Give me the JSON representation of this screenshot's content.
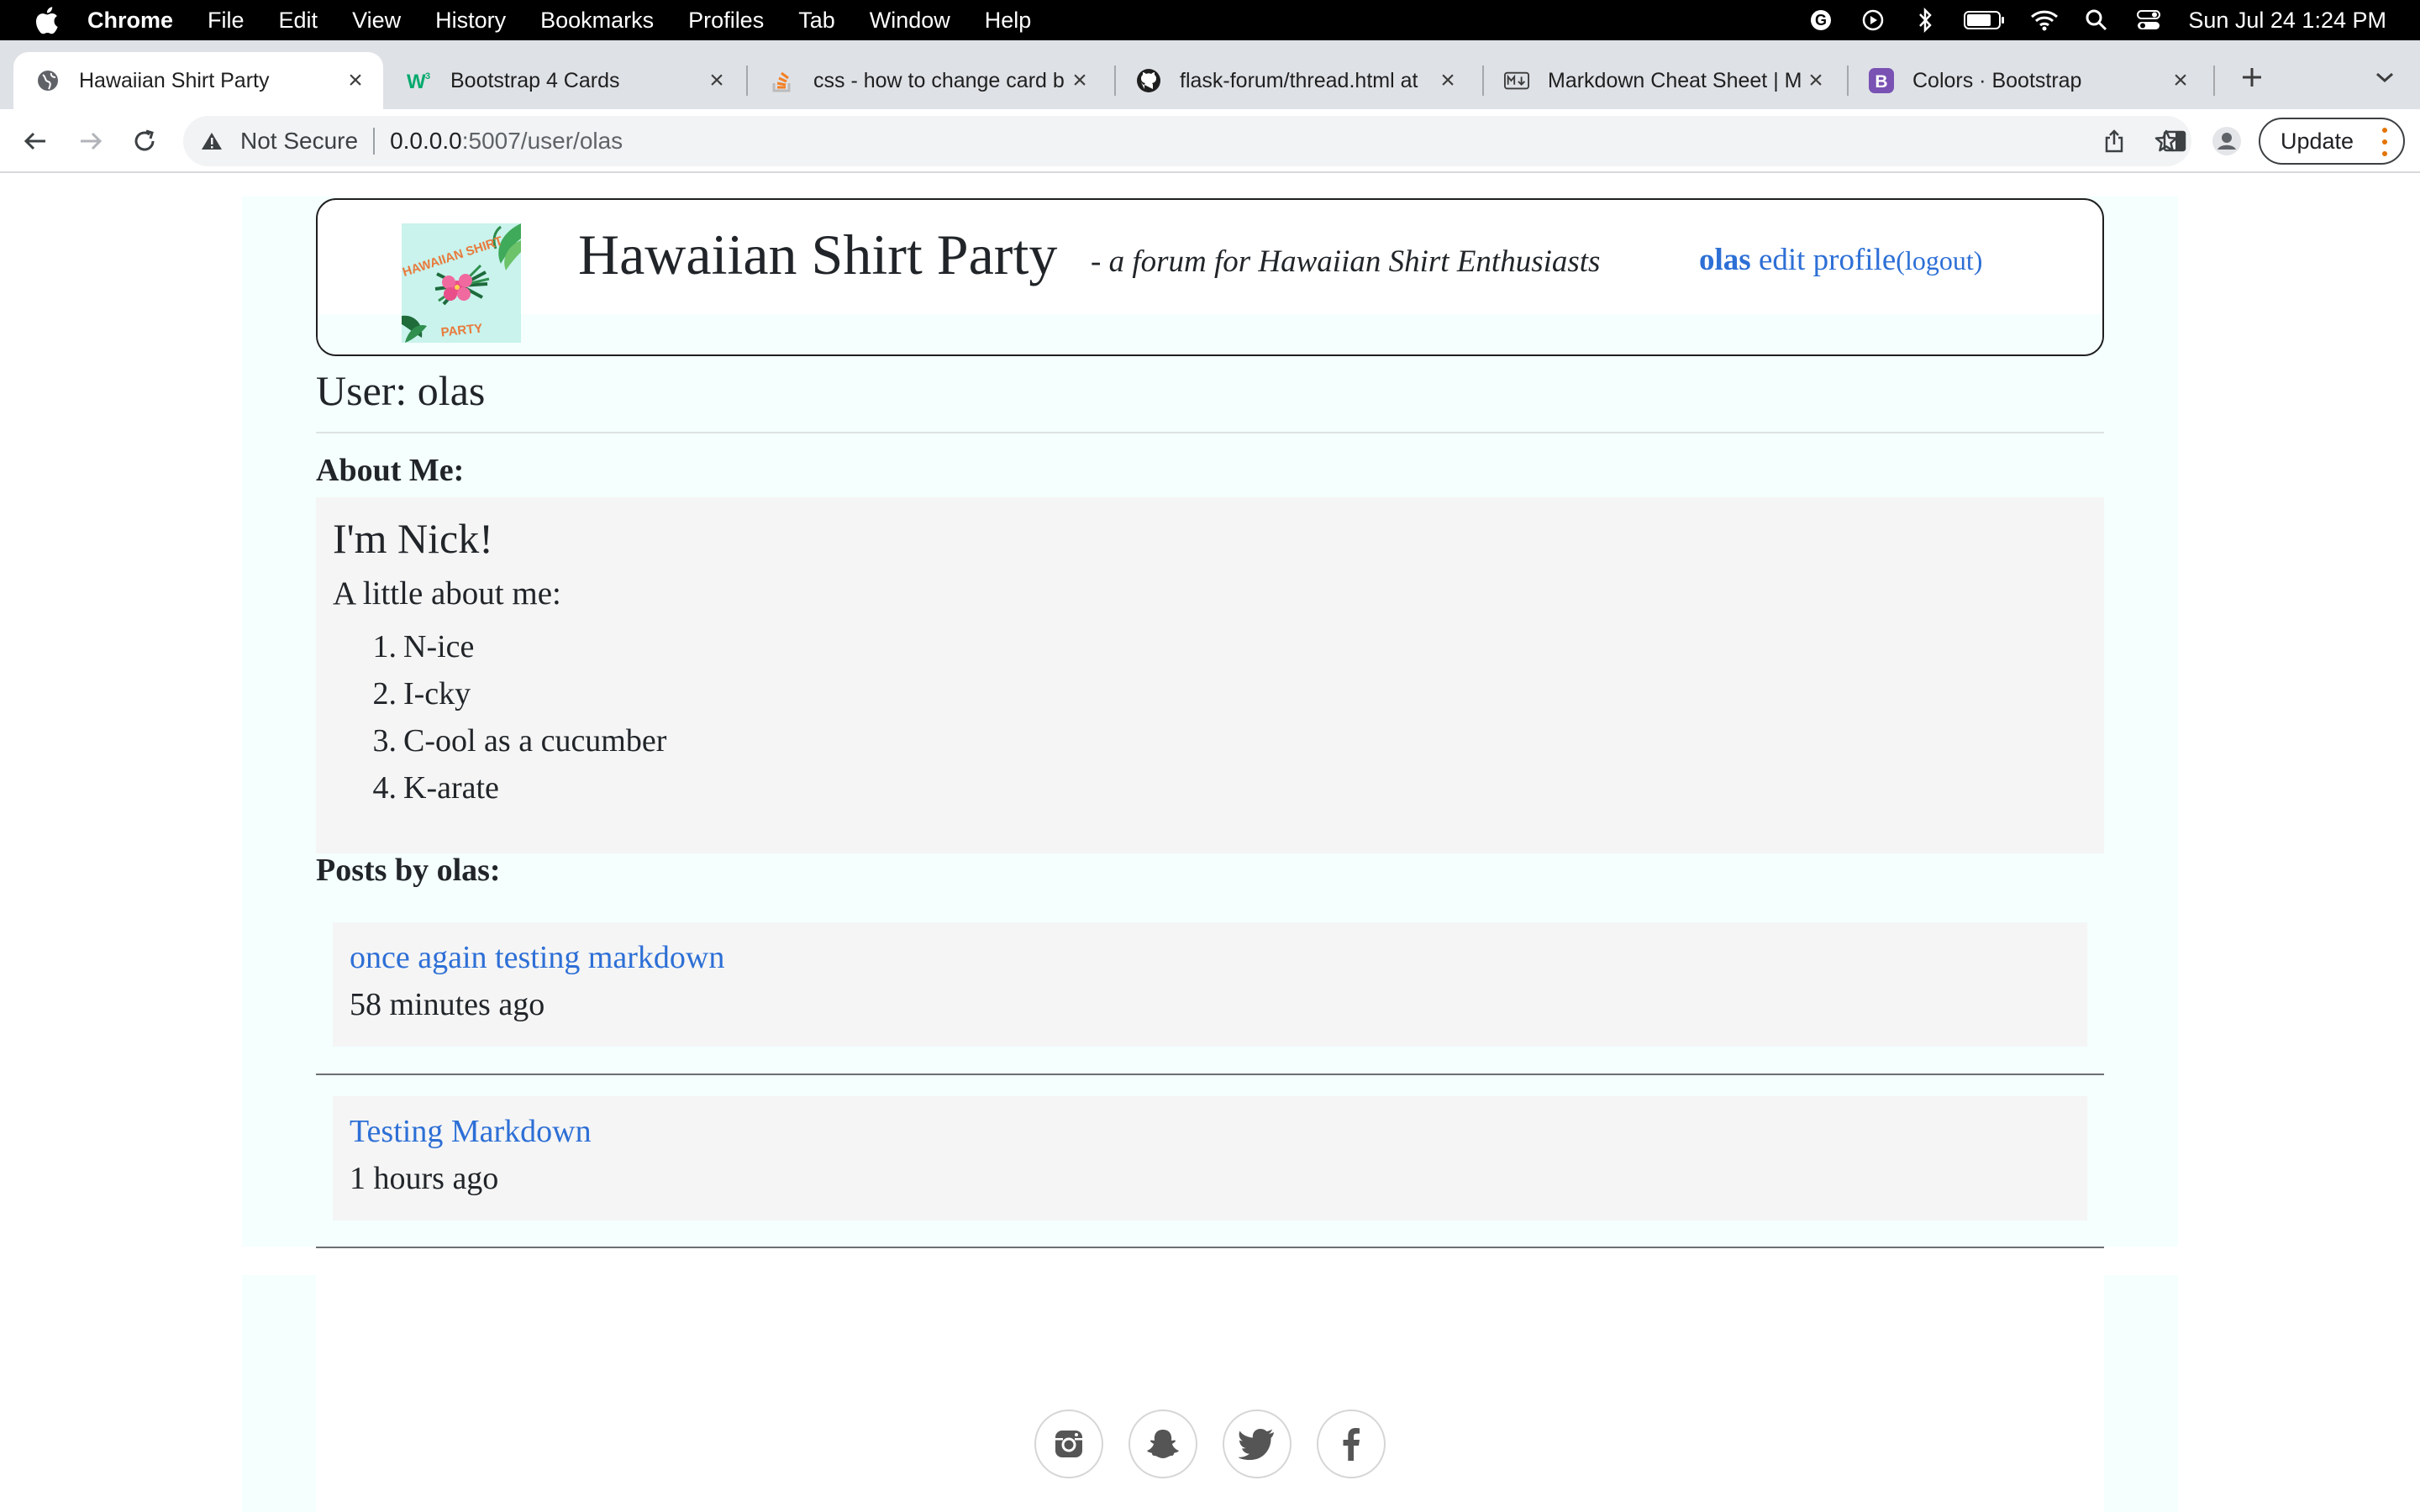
{
  "menubar": {
    "app": "Chrome",
    "items": [
      "File",
      "Edit",
      "View",
      "History",
      "Bookmarks",
      "Profiles",
      "Tab",
      "Window",
      "Help"
    ],
    "clock": "Sun Jul 24  1:24 PM"
  },
  "tabs": [
    {
      "title": "Hawaiian Shirt Party",
      "favicon": "globe-icon"
    },
    {
      "title": "Bootstrap 4 Cards",
      "favicon": "w3-icon"
    },
    {
      "title": "css - how to change card b",
      "favicon": "stackoverflow-icon"
    },
    {
      "title": "flask-forum/thread.html at",
      "favicon": "github-icon"
    },
    {
      "title": "Markdown Cheat Sheet | M",
      "favicon": "markdown-icon"
    },
    {
      "title": "Colors · Bootstrap",
      "favicon": "bootstrap-icon"
    }
  ],
  "toolbar": {
    "security_label": "Not Secure",
    "url_host": "0.0.0.0",
    "url_path": ":5007/user/olas",
    "update_label": "Update"
  },
  "header": {
    "logo_text_top": "HAWAIIAN SHIRT",
    "logo_text_bottom": "PARTY",
    "title": "Hawaiian Shirt Party",
    "tagline": "-  a forum for Hawaiian Shirt Enthusiasts",
    "username": "olas",
    "edit_profile": "edit profile",
    "logout": "(logout)"
  },
  "profile": {
    "heading": "User: olas",
    "about_label": "About Me:",
    "about_heading": "I'm Nick!",
    "about_intro": "A little about me:",
    "about_list": [
      {
        "num": "1.",
        "text": "N-ice"
      },
      {
        "num": "2.",
        "text": "I-cky"
      },
      {
        "num": "3.",
        "text": "C-ool as a cucumber"
      },
      {
        "num": "4.",
        "text": "K-arate"
      }
    ],
    "posts_label": "Posts by olas:",
    "posts": [
      {
        "title": "once again testing markdown",
        "time": "58 minutes ago"
      },
      {
        "title": "Testing Markdown",
        "time": "1 hours ago"
      }
    ]
  },
  "footer": {
    "social": [
      "instagram-icon",
      "snapchat-icon",
      "twitter-icon",
      "facebook-icon"
    ]
  },
  "colors": {
    "link": "#2d6fd6",
    "page_bg": "#f4fffe",
    "card_bg": "#f5f5f5"
  }
}
